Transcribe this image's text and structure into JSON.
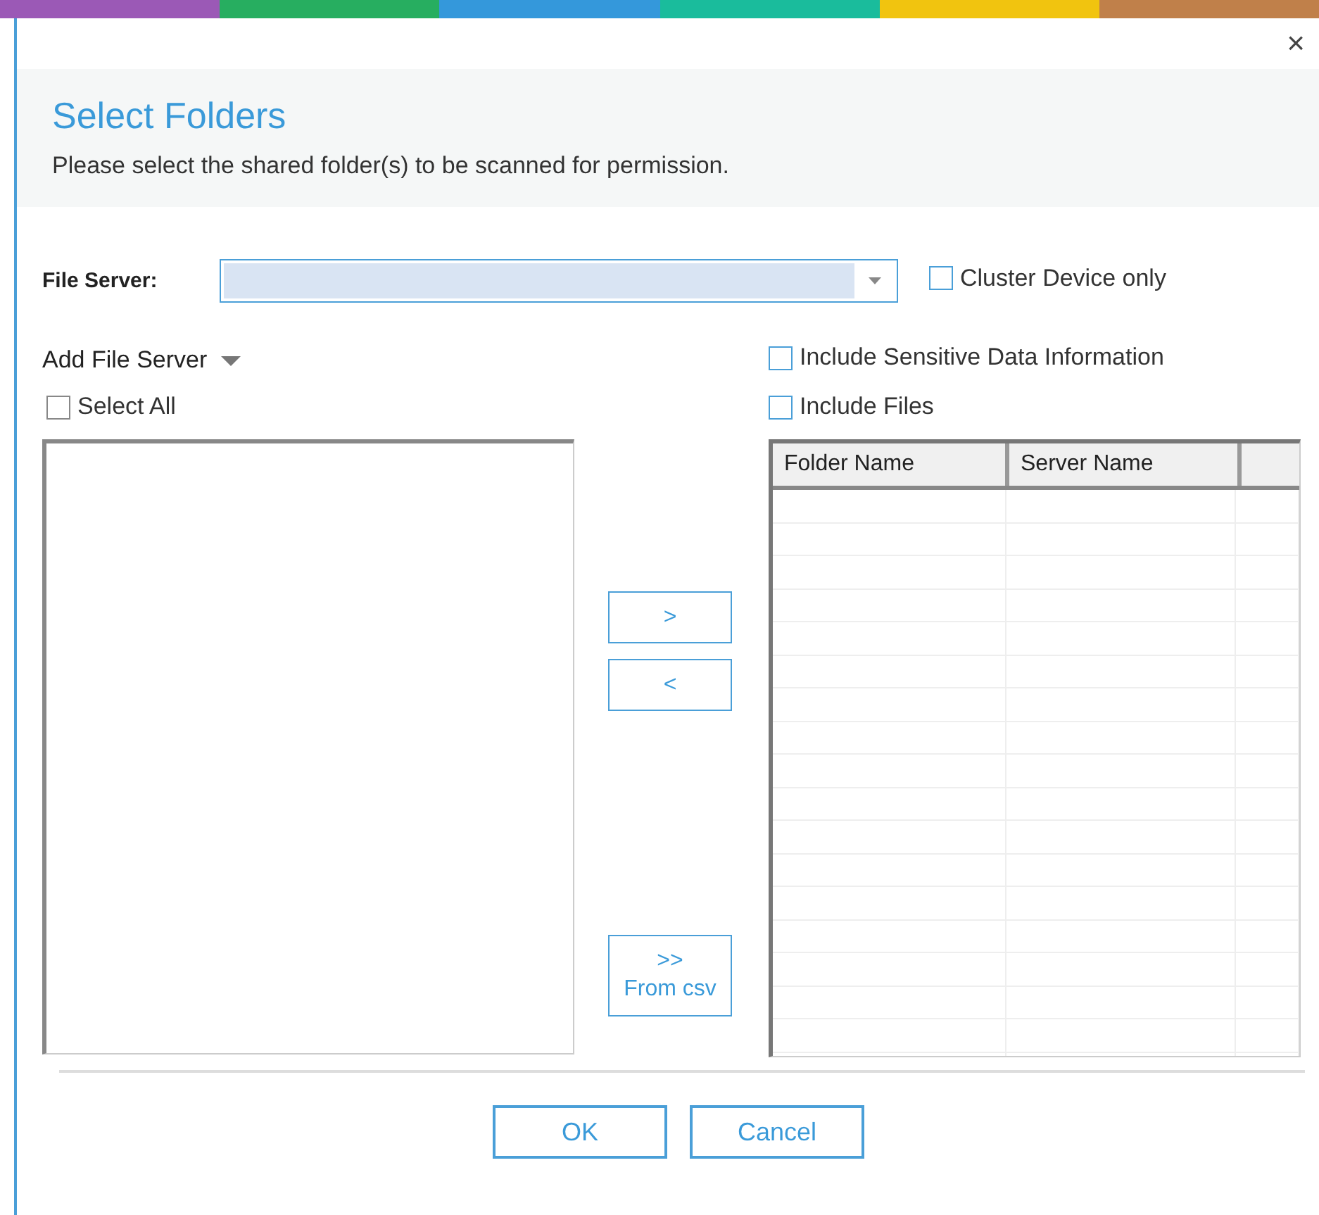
{
  "window": {
    "close": "×",
    "title": "Select Folders",
    "subtitle": "Please select the shared folder(s) to be scanned for permission."
  },
  "file_server": {
    "label": "File Server:"
  },
  "options": [
    {
      "label": "Cluster Device only",
      "checked": false
    },
    {
      "label": "Include Sensitive Data Information",
      "checked": false
    },
    {
      "label": "Include Files",
      "checked": false
    }
  ],
  "add_file_server": {
    "label": "Add File Server"
  },
  "select_all": {
    "label": "Select All",
    "checked": false
  },
  "move_buttons": [
    {
      "label": ">"
    },
    {
      "label": "<"
    },
    {
      "label": ">>",
      "label2": "From csv"
    }
  ],
  "table": {
    "columns": [
      "Folder Name",
      "Server Name"
    ]
  },
  "buttons": [
    "OK",
    "Cancel"
  ]
}
